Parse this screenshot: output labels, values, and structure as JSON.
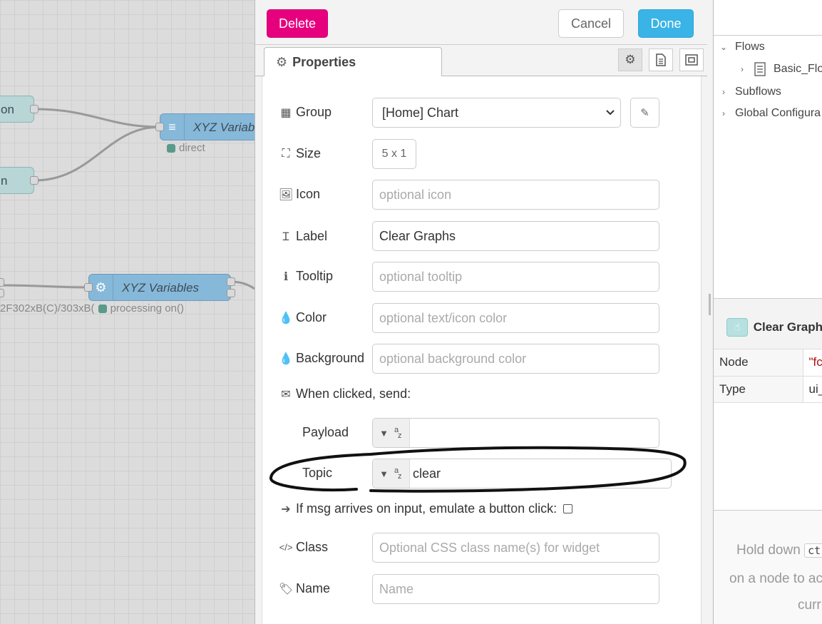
{
  "canvas": {
    "node_top_left_label": "on",
    "node_mid_left_label": "n",
    "node_xyz_variables_label": "XYZ Variab",
    "node_xyz_variables_status": "direct",
    "node_function_label": "XYZ Variables",
    "node_function_left_status": "2F302xB(C)/303xB(",
    "node_function_status": "processing on()"
  },
  "toolbar": {
    "delete_label": "Delete",
    "cancel_label": "Cancel",
    "done_label": "Done"
  },
  "tabs": {
    "properties_label": "Properties"
  },
  "form": {
    "group": {
      "label": "Group",
      "value": "[Home] Chart"
    },
    "size": {
      "label": "Size",
      "value": "5 x 1"
    },
    "icon": {
      "label": "Icon",
      "placeholder": "optional icon"
    },
    "label": {
      "label": "Label",
      "value": "Clear Graphs"
    },
    "tooltip": {
      "label": "Tooltip",
      "placeholder": "optional tooltip"
    },
    "color": {
      "label": "Color",
      "placeholder": "optional text/icon color"
    },
    "background": {
      "label": "Background",
      "placeholder": "optional background color"
    },
    "when_clicked": {
      "label": "When clicked, send:"
    },
    "payload": {
      "label": "Payload",
      "value": ""
    },
    "topic": {
      "label": "Topic",
      "value": "clear"
    },
    "emulate": {
      "label": "If msg arrives on input, emulate a button click:",
      "checked": false
    },
    "class": {
      "label": "Class",
      "placeholder": "Optional CSS class name(s) for widget"
    },
    "name": {
      "label": "Name",
      "placeholder": "Name"
    }
  },
  "sidebar": {
    "tree": {
      "flows_label": "Flows",
      "basic_flow_label": "Basic_Flo",
      "subflows_label": "Subflows",
      "global_config_label": "Global Configura"
    },
    "info": {
      "title": "Clear Graph",
      "rows": [
        {
          "key": "Node",
          "value": "\"fc"
        },
        {
          "key": "Type",
          "value": "ui_"
        }
      ]
    },
    "help": {
      "line1": "Hold down",
      "kbd": "ct",
      "line2": "on a node to ac",
      "line3": "curr"
    }
  }
}
